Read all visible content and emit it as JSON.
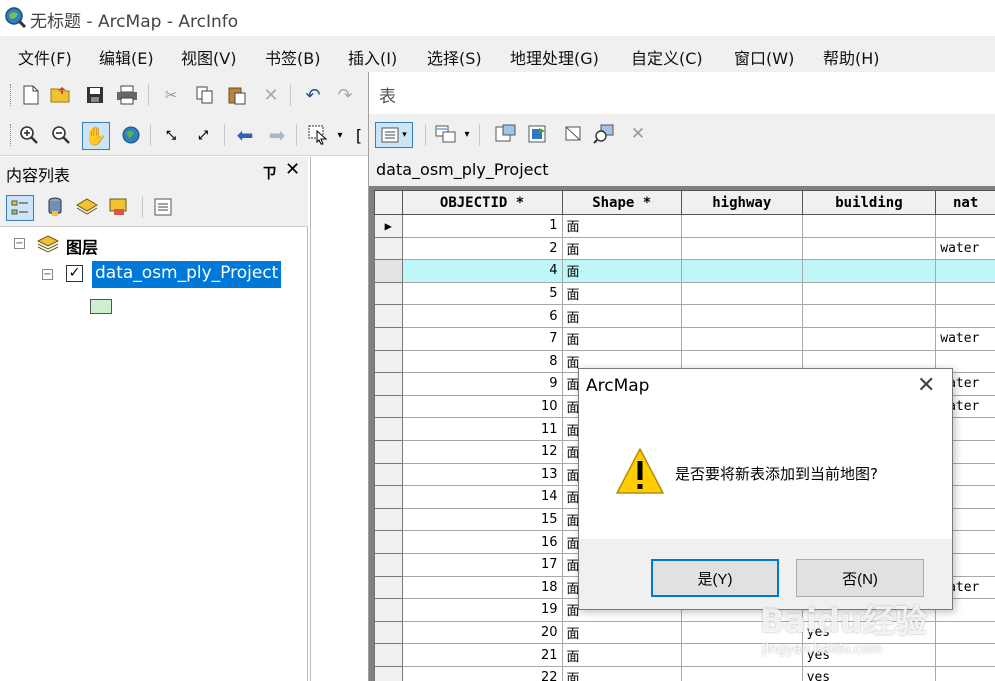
{
  "window": {
    "title": "无标题 - ArcMap - ArcInfo"
  },
  "menu": [
    "文件(F)",
    "编辑(E)",
    "视图(V)",
    "书签(B)",
    "插入(I)",
    "选择(S)",
    "地理处理(G)",
    "自定义(C)",
    "窗口(W)",
    "帮助(H)"
  ],
  "toc": {
    "title": "内容列表",
    "pin_glyph": "ㄗ",
    "close_glyph": "✕",
    "group_label": "图层",
    "layer_name": "data_osm_ply_Project",
    "layer_symbol_color": "#cdeecf"
  },
  "table_window": {
    "title": "表",
    "table_name": "data_osm_ply_Project",
    "columns": [
      "OBJECTID *",
      "Shape *",
      "highway",
      "building",
      "nat"
    ],
    "rows": [
      {
        "id": "1",
        "shape": "面",
        "highway": "",
        "building": "",
        "nat": "",
        "current": true
      },
      {
        "id": "2",
        "shape": "面",
        "highway": "",
        "building": "",
        "nat": "water"
      },
      {
        "id": "4",
        "shape": "面",
        "highway": "",
        "building": "",
        "nat": "",
        "selected": true
      },
      {
        "id": "5",
        "shape": "面",
        "highway": "",
        "building": "",
        "nat": ""
      },
      {
        "id": "6",
        "shape": "面",
        "highway": "",
        "building": "",
        "nat": ""
      },
      {
        "id": "7",
        "shape": "面",
        "highway": "",
        "building": "",
        "nat": "water"
      },
      {
        "id": "8",
        "shape": "面",
        "highway": "",
        "building": "",
        "nat": ""
      },
      {
        "id": "9",
        "shape": "面",
        "highway": "",
        "building": "",
        "nat": "water"
      },
      {
        "id": "10",
        "shape": "面",
        "highway": "",
        "building": "",
        "nat": "water"
      },
      {
        "id": "11",
        "shape": "面",
        "highway": "",
        "building": "",
        "nat": ""
      },
      {
        "id": "12",
        "shape": "面",
        "highway": "",
        "building": "",
        "nat": ""
      },
      {
        "id": "13",
        "shape": "面",
        "highway": "",
        "building": "",
        "nat": ""
      },
      {
        "id": "14",
        "shape": "面",
        "highway": "",
        "building": "",
        "nat": ""
      },
      {
        "id": "15",
        "shape": "面",
        "highway": "",
        "building": "",
        "nat": ""
      },
      {
        "id": "16",
        "shape": "面",
        "highway": "",
        "building": "",
        "nat": ""
      },
      {
        "id": "17",
        "shape": "面",
        "highway": "",
        "building": "",
        "nat": ""
      },
      {
        "id": "18",
        "shape": "面",
        "highway": "",
        "building": "",
        "nat": "water"
      },
      {
        "id": "19",
        "shape": "面",
        "highway": "",
        "building": "",
        "nat": ""
      },
      {
        "id": "20",
        "shape": "面",
        "highway": "",
        "building": "yes",
        "nat": ""
      },
      {
        "id": "21",
        "shape": "面",
        "highway": "",
        "building": "yes",
        "nat": ""
      },
      {
        "id": "22",
        "shape": "面",
        "highway": "",
        "building": "yes",
        "nat": ""
      }
    ]
  },
  "dialog": {
    "title": "ArcMap",
    "message": "是否要将新表添加到当前地图?",
    "yes_label": "是(Y)",
    "no_label": "否(N)",
    "close_glyph": "✕"
  },
  "watermark": {
    "text": "Baidu经验",
    "sub": "jingyan.baidu.com"
  },
  "colors": {
    "selected_row": "#bff6f8",
    "button_focus": "#0078d7",
    "warning": "#ffcc00"
  }
}
